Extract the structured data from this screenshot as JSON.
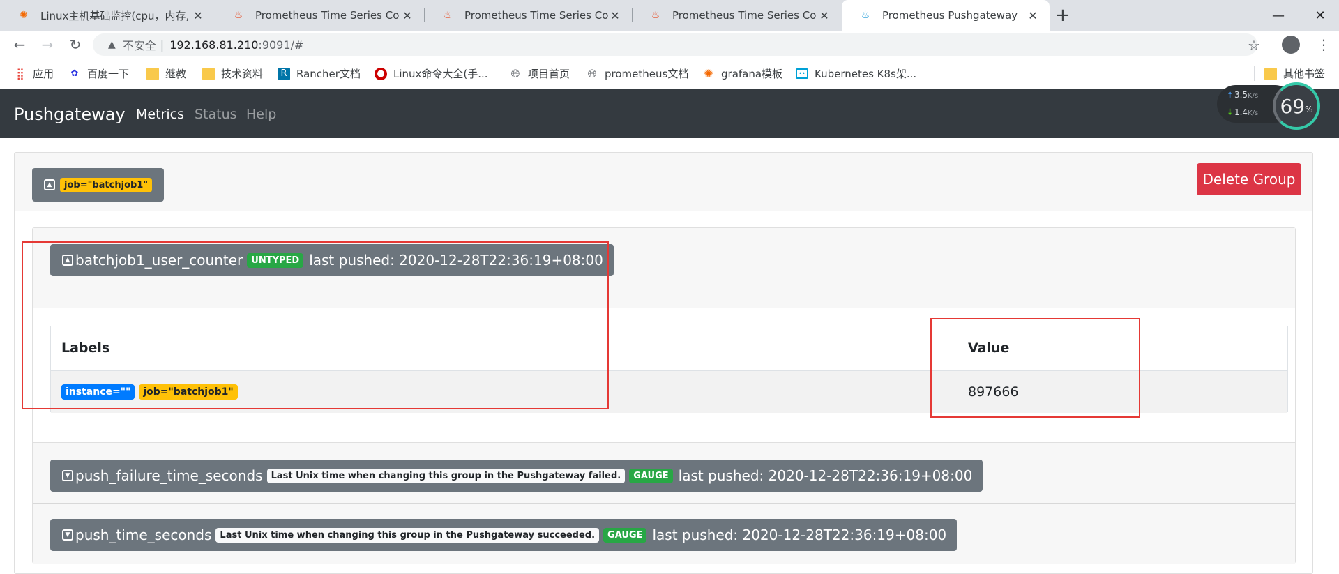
{
  "browser": {
    "tabs": [
      {
        "title": "Linux主机基础监控(cpu，内存,",
        "favicon": "grafana-icon",
        "active": false
      },
      {
        "title": "Prometheus Time Series Collec",
        "favicon": "prometheus-icon",
        "active": false
      },
      {
        "title": "Prometheus Time Series Collec",
        "favicon": "prometheus-icon",
        "active": false
      },
      {
        "title": "Prometheus Time Series Collec",
        "favicon": "prometheus-icon",
        "active": false
      },
      {
        "title": "Prometheus Pushgateway",
        "favicon": "pushgateway-icon",
        "active": true
      }
    ],
    "new_tab": "+",
    "address": {
      "security_label": "不安全",
      "host": "192.168.81.210",
      "path": ":9091/#"
    },
    "bookmarks": [
      {
        "label": "应用",
        "icon": "apps-icon"
      },
      {
        "label": "百度一下",
        "icon": "baidu-icon"
      },
      {
        "label": "继教",
        "icon": "folder-icon"
      },
      {
        "label": "技术资料",
        "icon": "folder-icon"
      },
      {
        "label": "Rancher文档",
        "icon": "rancher-icon"
      },
      {
        "label": "Linux命令大全(手...",
        "icon": "redhat-icon"
      },
      {
        "label": "项目首页",
        "icon": "globe-icon"
      },
      {
        "label": "prometheus文档",
        "icon": "globe-icon"
      },
      {
        "label": "grafana模板",
        "icon": "grafana-icon"
      },
      {
        "label": "Kubernetes K8s架...",
        "icon": "bilibili-icon"
      },
      {
        "label": "其他书签",
        "icon": "folder-icon"
      }
    ]
  },
  "net_widget": {
    "up": "3.5",
    "down": "1.4",
    "unit": "K/s",
    "percent": "69",
    "percent_sign": "%"
  },
  "nav": {
    "brand": "Pushgateway",
    "links": [
      {
        "label": "Metrics",
        "active": true
      },
      {
        "label": "Status",
        "active": false
      },
      {
        "label": "Help",
        "active": false
      }
    ]
  },
  "group": {
    "label": "job=\"batchjob1\"",
    "delete_label": "Delete Group"
  },
  "metrics": [
    {
      "name": "batchjob1_user_counter",
      "help": "",
      "type": "UNTYPED",
      "last_pushed": "last pushed: 2020-12-28T22:36:19+08:00",
      "expanded": true
    },
    {
      "name": "push_failure_time_seconds",
      "help": "Last Unix time when changing this group in the Pushgateway failed.",
      "type": "GAUGE",
      "last_pushed": "last pushed: 2020-12-28T22:36:19+08:00",
      "expanded": false
    },
    {
      "name": "push_time_seconds",
      "help": "Last Unix time when changing this group in the Pushgateway succeeded.",
      "type": "GAUGE",
      "last_pushed": "last pushed: 2020-12-28T22:36:19+08:00",
      "expanded": false
    }
  ],
  "table": {
    "headers": {
      "labels": "Labels",
      "value": "Value"
    },
    "rows": [
      {
        "labels": [
          "instance=\"\"",
          "job=\"batchjob1\""
        ],
        "value": "897666"
      }
    ]
  },
  "colors": {
    "navbar": "#343a40",
    "danger": "#dc3545",
    "success": "#28a745",
    "warning": "#ffc107",
    "primary": "#007bff",
    "secondary": "#6c757d",
    "annotation": "#e53935"
  }
}
